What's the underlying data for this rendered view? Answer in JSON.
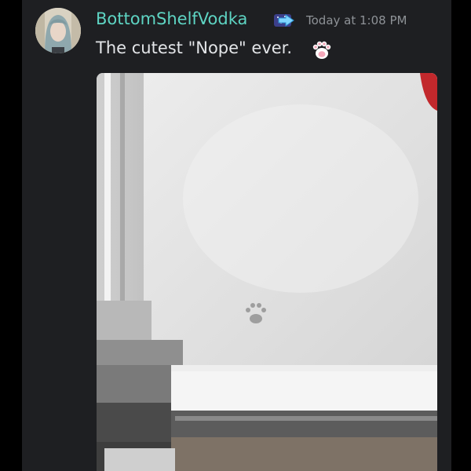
{
  "message": {
    "author": "BottomShelfVodka",
    "timestamp": "Today at 1:08 PM",
    "text": "The cutest \"Nope\" ever.",
    "emoji": "paw-emoji",
    "role_icon": "arrow-right-icon"
  },
  "attachment": {
    "type": "image",
    "subject": "paw print in snow"
  },
  "colors": {
    "username": "#5ed4c3",
    "timestamp": "#8e9297",
    "message_text": "#e3e5e8",
    "background": "#1e1f22"
  }
}
